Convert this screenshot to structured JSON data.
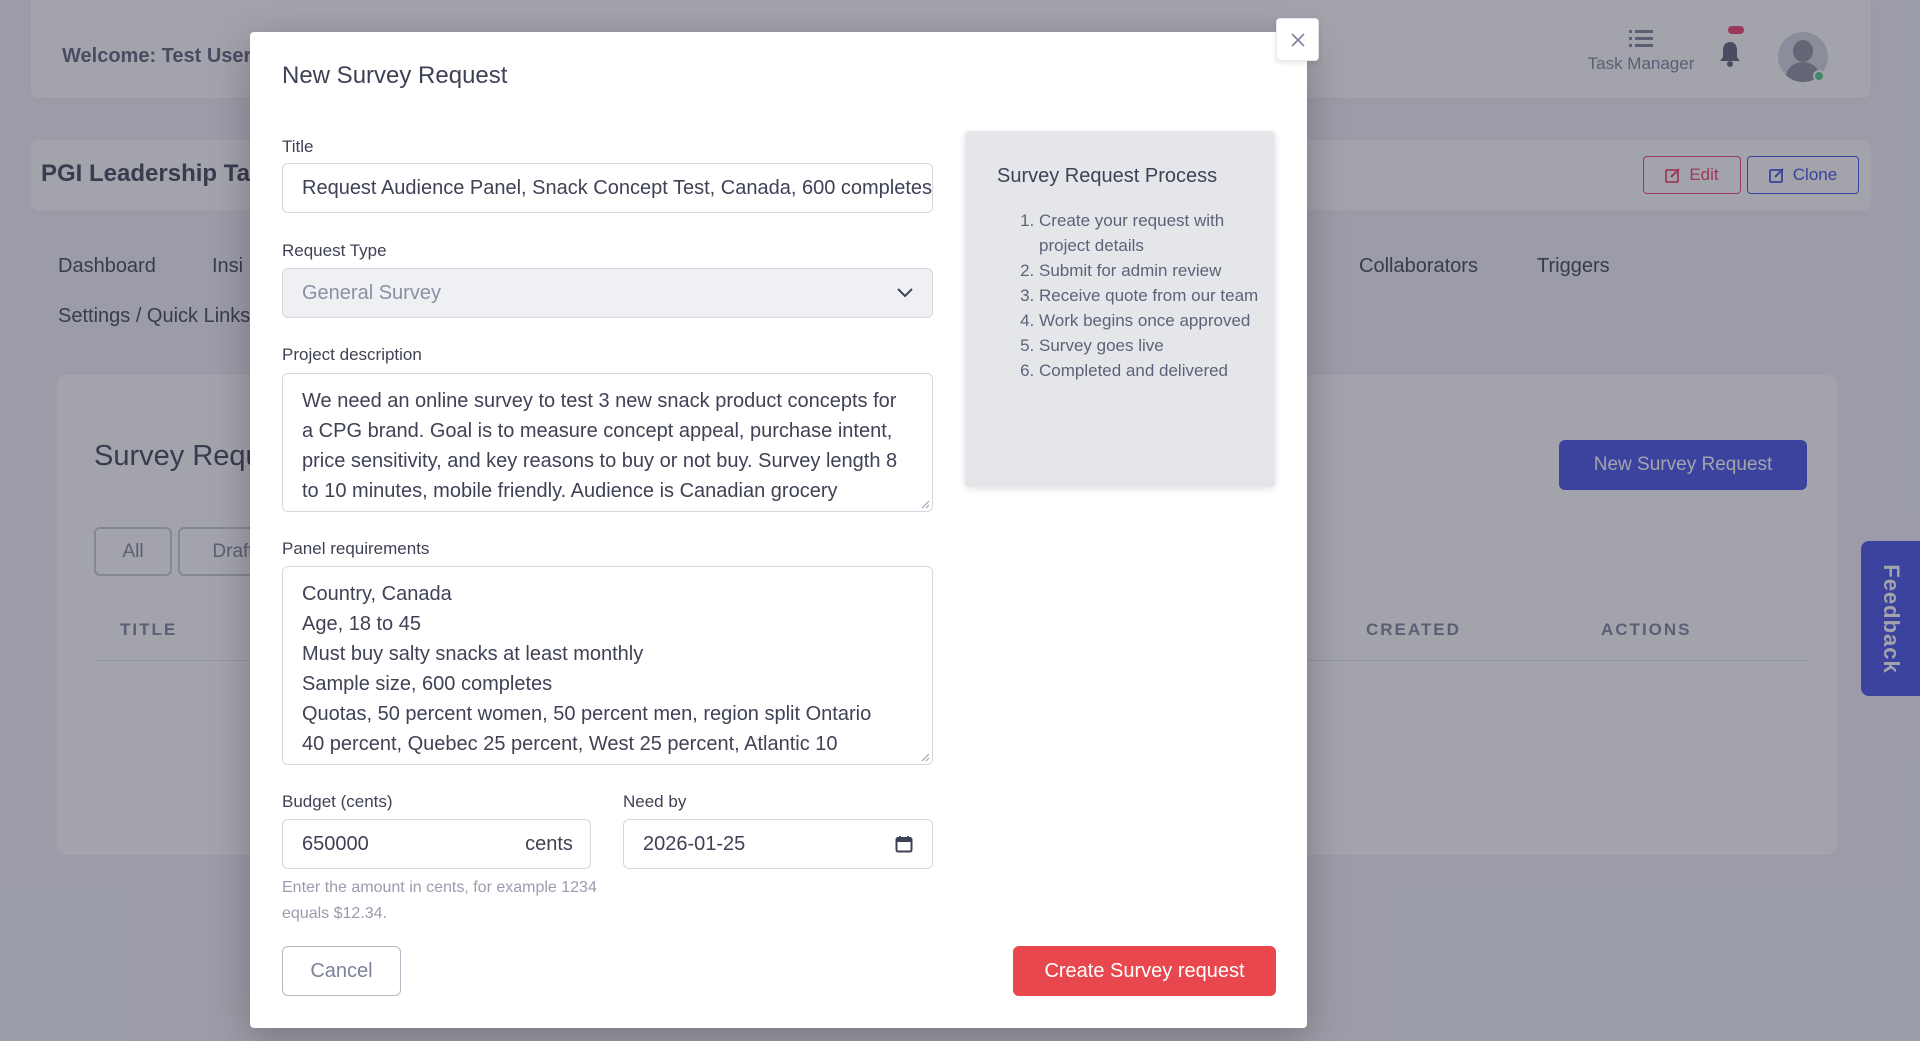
{
  "header": {
    "welcome": "Welcome: Test User",
    "task_manager_label": "Task Manager",
    "icons": [
      "list-icon",
      "bell-icon",
      "avatar"
    ]
  },
  "project": {
    "title": "PGI Leadership Tal",
    "edit_label": "Edit",
    "clone_label": "Clone"
  },
  "nav": {
    "dashboard": "Dashboard",
    "insights": "Insi",
    "collaborators": "Collaborators",
    "triggers": "Triggers",
    "settings": "Settings / Quick Links"
  },
  "survey_section": {
    "heading": "Survey Requ",
    "new_button": "New Survey Request",
    "filters": [
      "All",
      "Draft"
    ],
    "columns": {
      "title": "TITLE",
      "created": "CREATED",
      "actions": "ACTIONS"
    }
  },
  "feedback": "Feedback",
  "modal": {
    "title": "New Survey Request",
    "fields": {
      "title_label": "Title",
      "title_value": "Request Audience Panel, Snack Concept Test, Canada, 600 completes",
      "request_type_label": "Request Type",
      "request_type_value": "General Survey",
      "description_label": "Project description",
      "description_value": "We need an online survey to test 3 new snack product concepts for a CPG brand. Goal is to measure concept appeal, purchase intent, price sensitivity, and key reasons to buy or not buy. Survey length 8 to 10 minutes, mobile friendly. Audience is Canadian grocery shoppers who buy salty snacks at least once a month. We will share",
      "panel_label": "Panel requirements",
      "panel_lines": [
        "Country, Canada",
        "Age, 18 to 45",
        "Must buy salty snacks at least monthly",
        "Sample size, 600 completes",
        "Quotas, 50 percent women, 50 percent men, region split Ontario",
        "40 percent, Quebec 25 percent, West 25 percent, Atlantic 10"
      ],
      "budget_label": "Budget (cents)",
      "budget_value": "650000",
      "budget_addon": "cents",
      "budget_hint": "Enter the amount in cents, for example 1234 equals $12.34.",
      "need_by_label": "Need by",
      "need_by_value": "2026-01-25"
    },
    "process": {
      "title": "Survey Request Process",
      "steps": [
        "Create your request with project details",
        "Submit for admin review",
        "Receive quote from our team",
        "Work begins once approved",
        "Survey goes live",
        "Completed and delivered"
      ]
    },
    "cancel_label": "Cancel",
    "create_label": "Create Survey request"
  },
  "colors": {
    "primary": "#4350e8",
    "danger": "#e8474d",
    "overlay": "#32344873"
  }
}
